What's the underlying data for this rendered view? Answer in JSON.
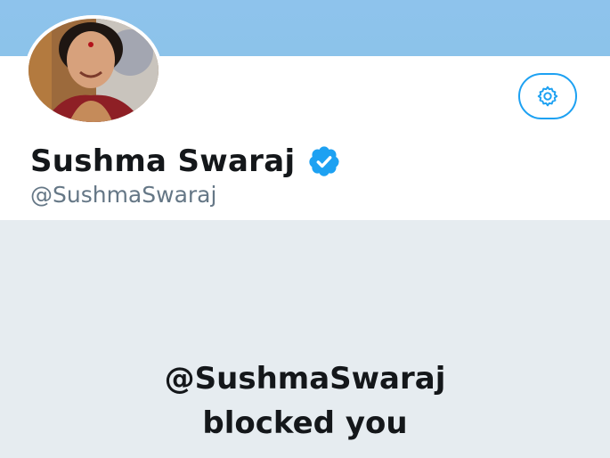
{
  "profile": {
    "display_name": "Sushma Swaraj",
    "handle": "@SushmaSwaraj",
    "verified": true,
    "avatar_alt": "Sushma Swaraj profile photo"
  },
  "header": {
    "settings_icon": "gear-icon"
  },
  "blocked_notice": {
    "line1": "@SushmaSwaraj",
    "line2": "blocked you"
  },
  "colors": {
    "banner": "#8ec3ec",
    "accent": "#1da1f2",
    "background": "#e6ecf0",
    "text": "#14171a",
    "muted": "#657786"
  }
}
